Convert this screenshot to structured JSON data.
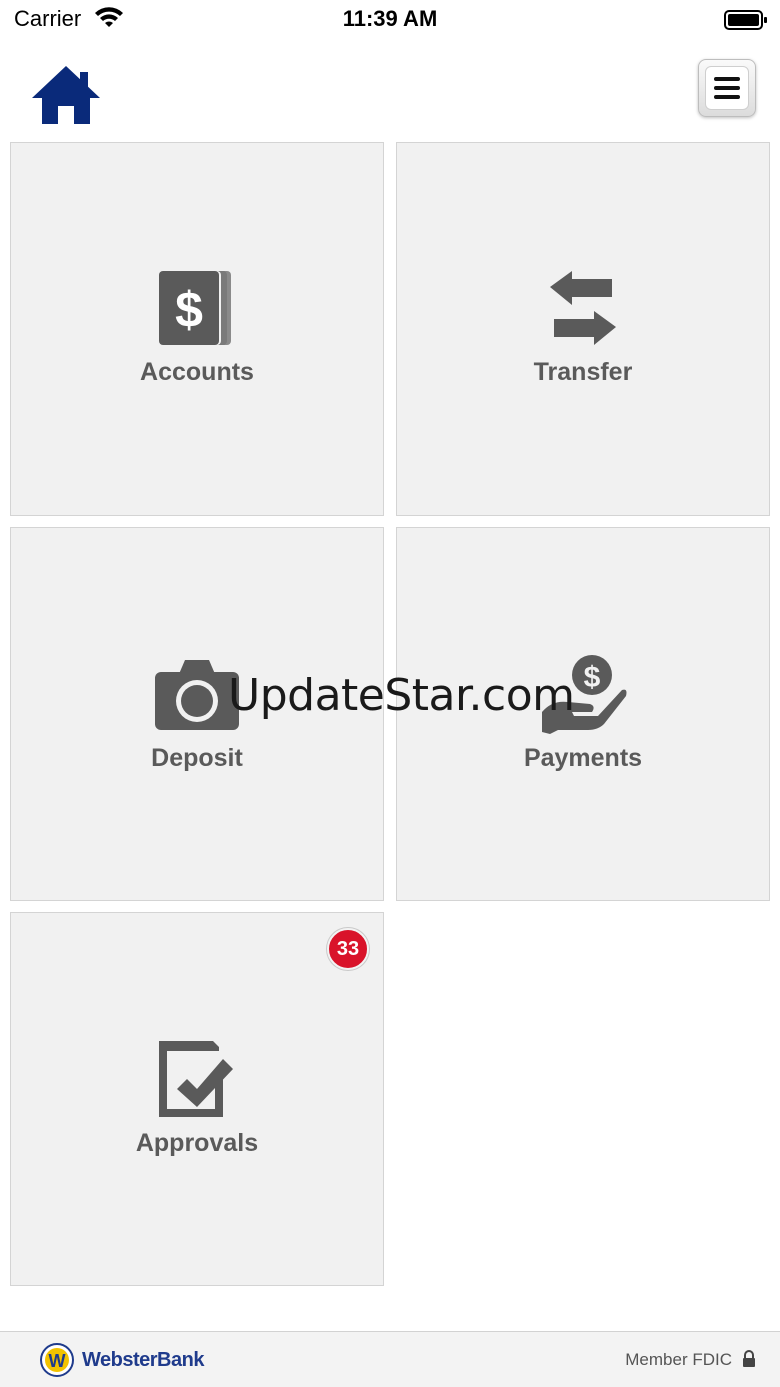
{
  "status_bar": {
    "carrier": "Carrier",
    "time": "11:39 AM"
  },
  "header": {
    "home_icon": "home-icon",
    "menu_icon": "hamburger-menu-icon"
  },
  "tiles": [
    {
      "label": "Accounts",
      "icon": "dollar-cards-icon"
    },
    {
      "label": "Transfer",
      "icon": "transfer-arrows-icon"
    },
    {
      "label": "Deposit",
      "icon": "camera-icon"
    },
    {
      "label": "Payments",
      "icon": "hand-coin-icon"
    },
    {
      "label": "Approvals",
      "icon": "checkbox-icon",
      "badge": "33"
    }
  ],
  "watermark": "UpdateStar.com",
  "footer": {
    "brand": "WebsterBank",
    "fdic": "Member FDIC"
  },
  "colors": {
    "brand_blue": "#0a2a7a",
    "badge_red": "#d9132a",
    "icon_gray": "#5a5a5a",
    "tile_bg": "#f1f1f1"
  }
}
